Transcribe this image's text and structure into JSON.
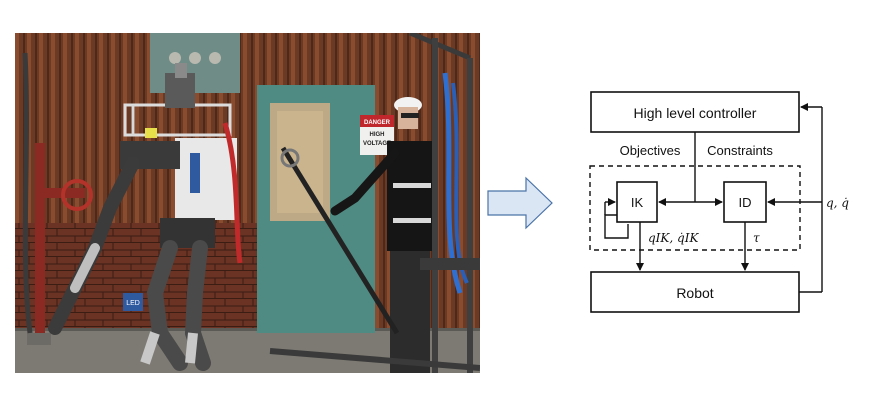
{
  "photo": {
    "sign_text_line1": "DANGER",
    "sign_text_line2": "HIGH",
    "sign_text_line3": "VOLTAGE",
    "robot_leg_text": "LED"
  },
  "arrow": {
    "fill": "#dbe6f5",
    "stroke": "#4a73a8"
  },
  "diagram": {
    "high_level_controller": "High level controller",
    "objectives": "Objectives",
    "constraints": "Constraints",
    "ik": "IK",
    "id": "ID",
    "robot": "Robot",
    "feedback_label": "q, q̇",
    "ik_output_label": "qIK, q̇IK",
    "tau_label": "τ"
  }
}
